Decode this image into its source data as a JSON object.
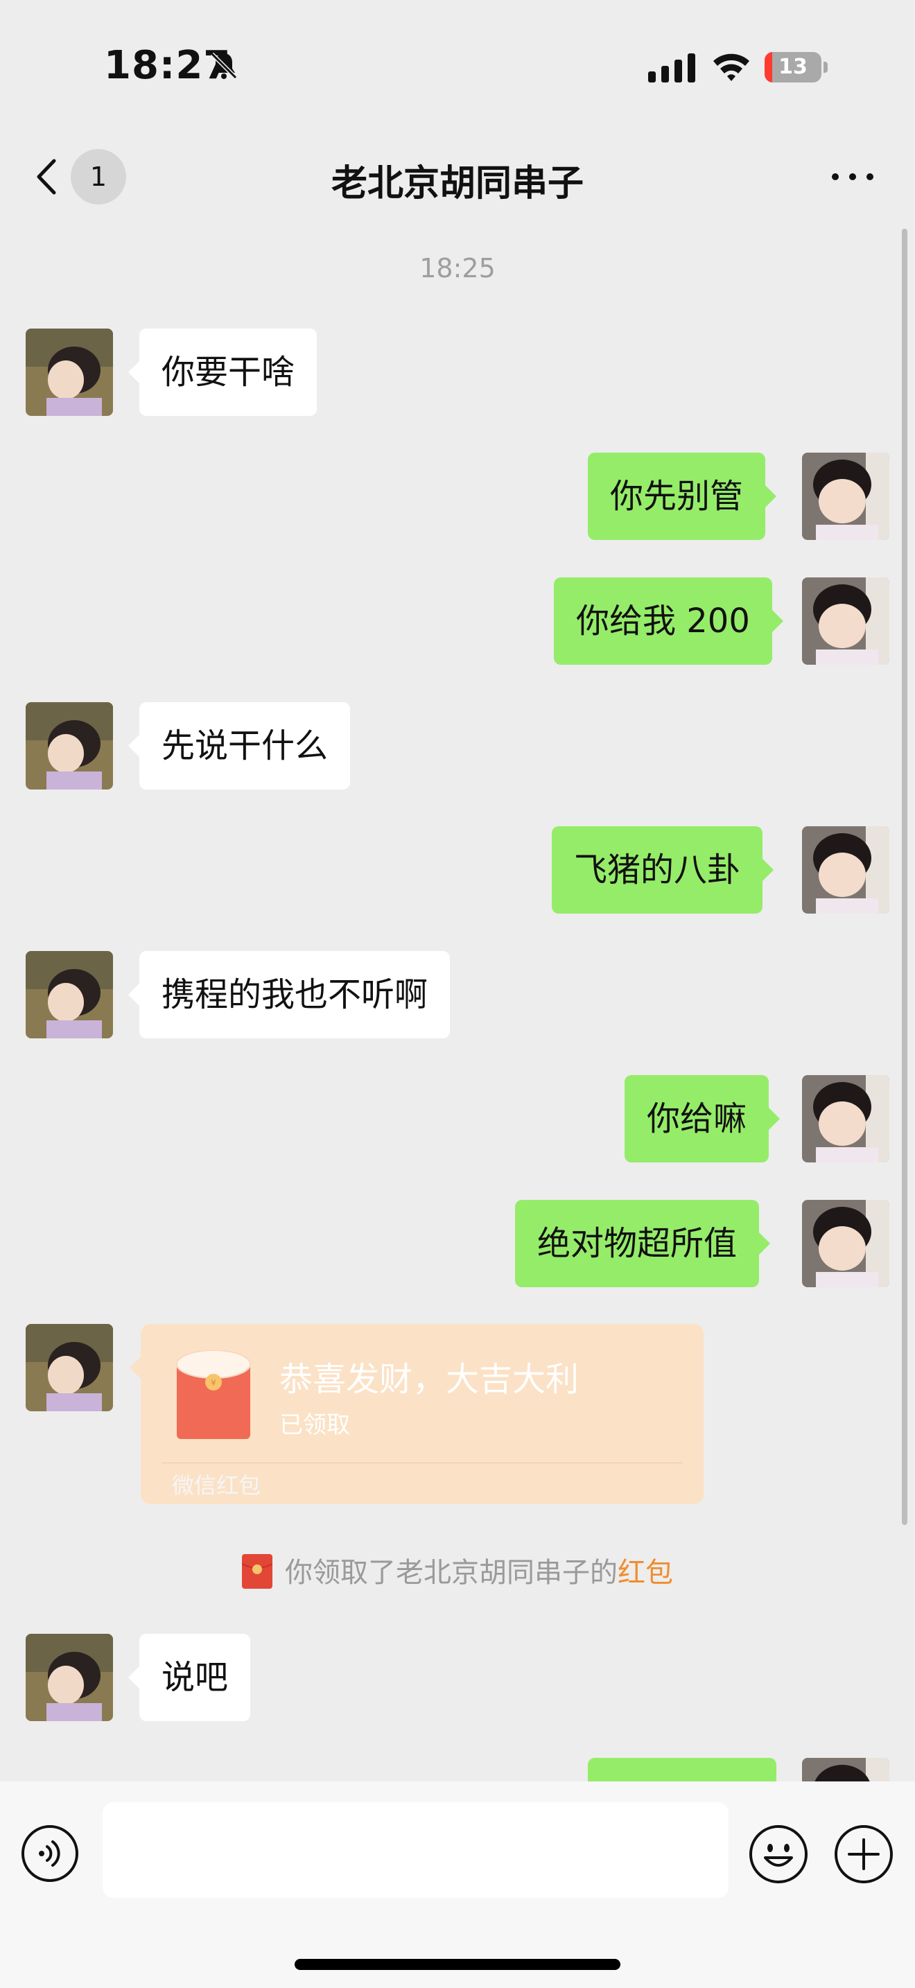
{
  "status_bar": {
    "time": "18:27",
    "battery_level": "13",
    "battery_percent": 13
  },
  "nav": {
    "back_count": "1",
    "title": "老北京胡同串子"
  },
  "timestamp": "18:25",
  "messages": [
    {
      "side": "left",
      "text": "你要干啥"
    },
    {
      "side": "right",
      "text": "你先别管"
    },
    {
      "side": "right",
      "text": "你给我 200"
    },
    {
      "side": "left",
      "text": "先说干什么"
    },
    {
      "side": "right",
      "text": "飞猪的八卦"
    },
    {
      "side": "left",
      "text": "携程的我也不听啊"
    },
    {
      "side": "right",
      "text": "你给嘛"
    },
    {
      "side": "right",
      "text": "绝对物超所值"
    },
    {
      "side": "left",
      "text": "说吧"
    }
  ],
  "red_packet": {
    "title": "恭喜发财，大吉大利",
    "status": "已领取",
    "label": "微信红包"
  },
  "system_notice": {
    "prefix": "你领取了老北京胡同串子的",
    "link": "红包"
  },
  "input": {
    "placeholder": ""
  },
  "colors": {
    "self_bubble": "#95ec69",
    "other_bubble": "#ffffff",
    "background": "#ededed",
    "red_packet": "#fbe1c6",
    "link_orange": "#f08d2e"
  },
  "icons": [
    "bell-slash-icon",
    "signal-icon",
    "wifi-icon",
    "battery-icon",
    "back-arrow-icon",
    "more-icon",
    "red-packet-icon",
    "voice-icon",
    "emoji-icon",
    "add-icon"
  ]
}
